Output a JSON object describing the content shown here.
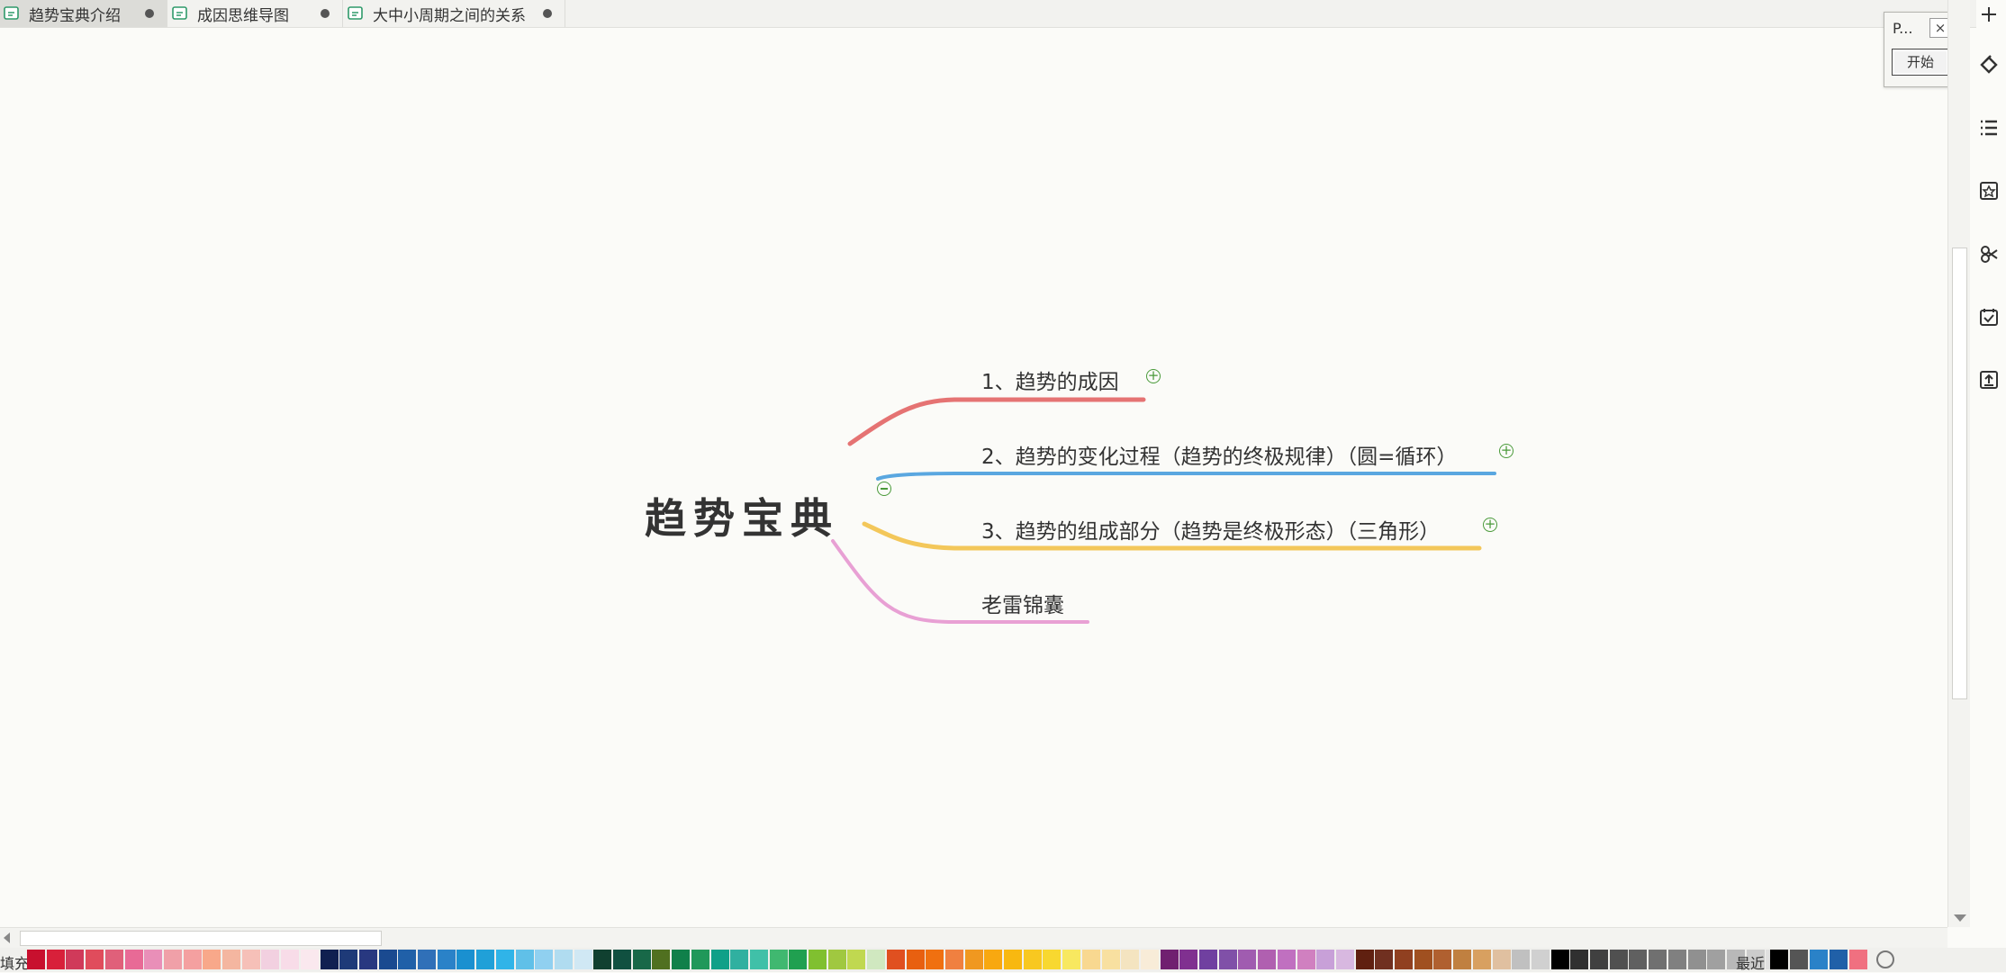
{
  "tabs": [
    {
      "label": "趋势宝典介绍",
      "active": true
    },
    {
      "label": "成因思维导图",
      "active": false
    },
    {
      "label": "大中小周期之间的关系",
      "active": false
    }
  ],
  "mindmap": {
    "central": "趋势宝典",
    "branches": [
      {
        "label": "1、趋势的成因",
        "color": "#e57373",
        "collapsed": true
      },
      {
        "label": "2、趋势的变化过程（趋势的终极规律）（圆=循环）",
        "color": "#5aa7e0",
        "collapsed": true
      },
      {
        "label": "3、趋势的组成部分（趋势是终极形态）（三角形）",
        "color": "#f3c75a",
        "collapsed": true
      },
      {
        "label": "老雷锦囊",
        "color": "#e8a0d4",
        "collapsed": false
      }
    ],
    "expander_plus": "+",
    "expander_minus": "−"
  },
  "mini_panel": {
    "title": "P...",
    "close_label": "×",
    "start_label": "开始"
  },
  "sidebar_icons": [
    "style-icon",
    "outline-icon",
    "icon-library-icon",
    "clip-icon",
    "task-icon",
    "export-icon"
  ],
  "palette": {
    "fill_label": "填充",
    "recent_label": "最近",
    "colors": [
      "#c8102e",
      "#d8203a",
      "#d03a5a",
      "#e04c5c",
      "#e0607a",
      "#e86a96",
      "#e98fb8",
      "#f0a0a8",
      "#f4a0a0",
      "#f8a88a",
      "#f4b6a0",
      "#f6c0b8",
      "#f2d0e0",
      "#f8dce8",
      "#fae8ee",
      "#102050",
      "#1e3a78",
      "#283880",
      "#1a4a90",
      "#2060a8",
      "#3070b8",
      "#2a82c8",
      "#1a90d0",
      "#20a0d8",
      "#30b4e8",
      "#60c0e8",
      "#90d0f0",
      "#b0dcf0",
      "#d0e8f4",
      "#104030",
      "#105040",
      "#186848",
      "#507020",
      "#10804a",
      "#20985a",
      "#10a088",
      "#30b0a0",
      "#40c0a8",
      "#40b870",
      "#20a050",
      "#80c030",
      "#a0c840",
      "#c0d850",
      "#d0e8c0",
      "#e05020",
      "#e86010",
      "#f07010",
      "#f08040",
      "#f09820",
      "#f8a810",
      "#f8b810",
      "#f8c820",
      "#f8d830",
      "#f8e860",
      "#f8d890",
      "#f8e0a0",
      "#f4e4c0",
      "#f8ecd8",
      "#702070",
      "#803090",
      "#7040a0",
      "#8050a8",
      "#a05cb0",
      "#b060b0",
      "#c070c0",
      "#d080c0",
      "#c8a0d8",
      "#d8b8e0",
      "#602010",
      "#703020",
      "#904020",
      "#a05020",
      "#b06030",
      "#c08040",
      "#d8a060",
      "#e0c0a0",
      "#c0c0c0",
      "#d0d0d0",
      "#000000",
      "#303030",
      "#404040",
      "#505050",
      "#606060",
      "#707070",
      "#808080",
      "#909090",
      "#a0a0a0",
      "#b8b8b8",
      "#cccccc",
      "#e0e0e0"
    ],
    "recent_colors": [
      "#000000",
      "#555555",
      "#2a82c8",
      "#2060a8",
      "#f07080"
    ]
  }
}
